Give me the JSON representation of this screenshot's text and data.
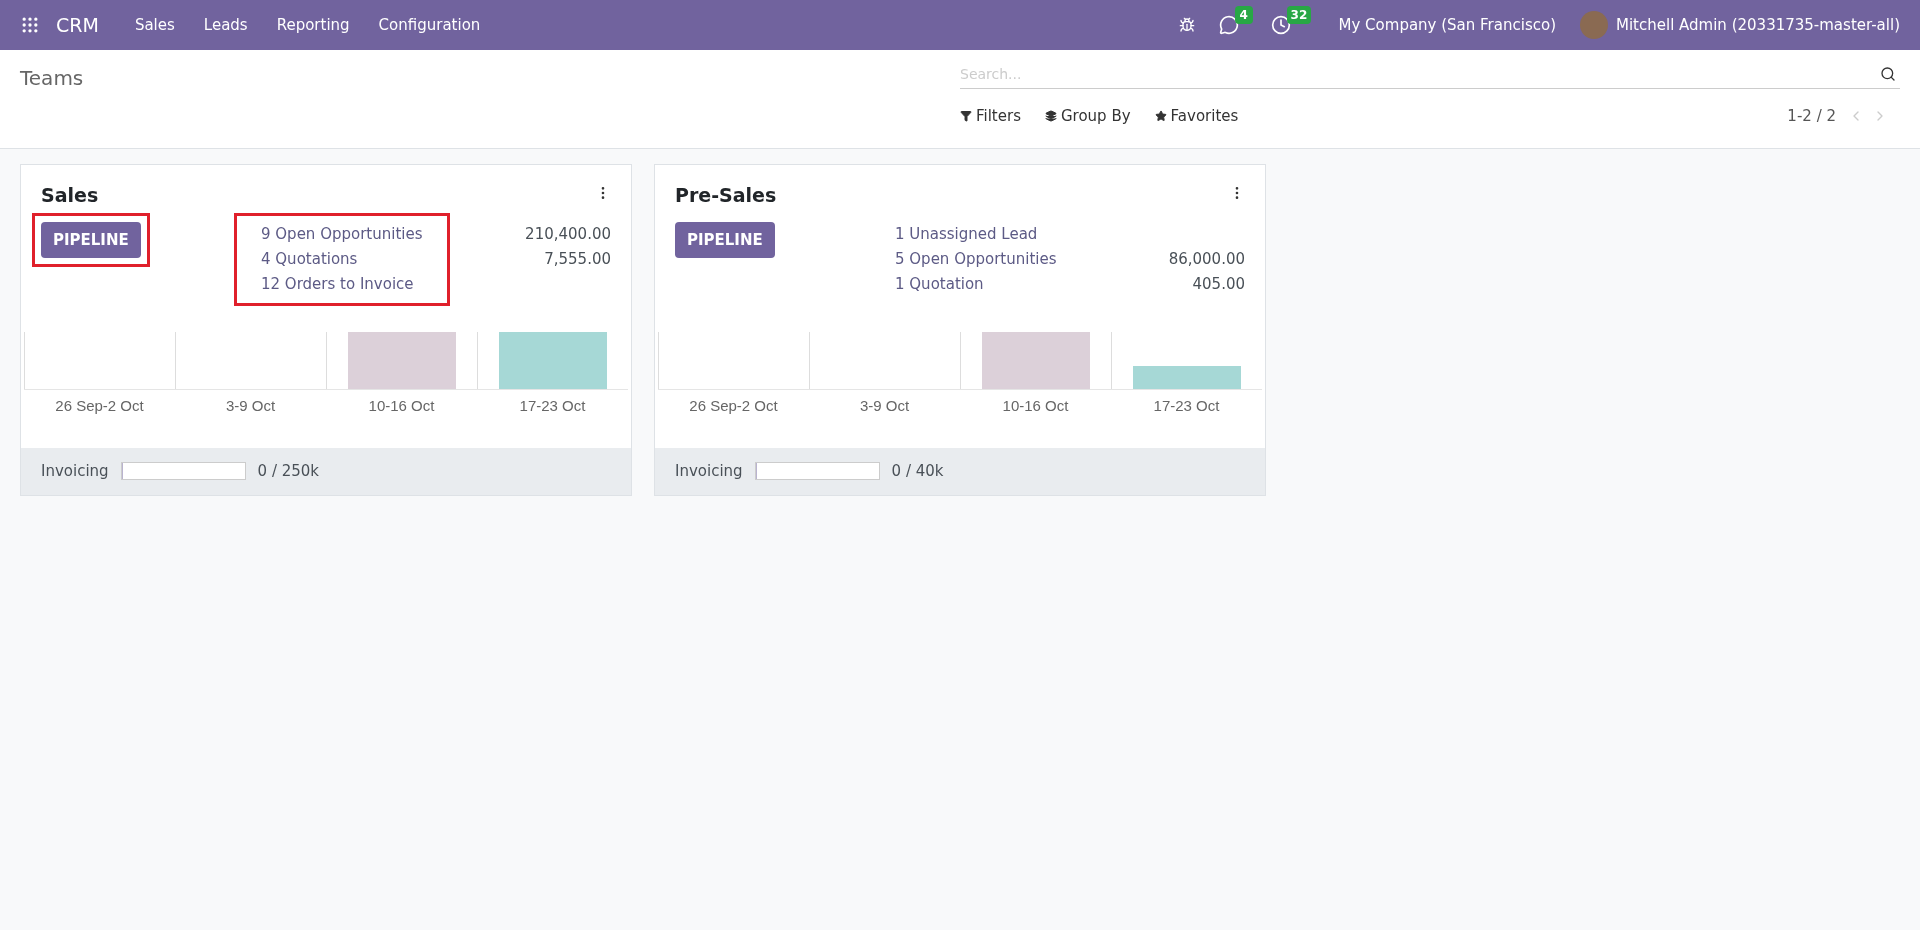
{
  "navbar": {
    "app": "CRM",
    "menu": [
      "Sales",
      "Leads",
      "Reporting",
      "Configuration"
    ],
    "messages_count": "4",
    "activities_count": "32",
    "company": "My Company (San Francisco)",
    "user": "Mitchell Admin (20331735-master-all)"
  },
  "control_panel": {
    "title": "Teams",
    "search": {
      "placeholder": "Search..."
    },
    "filters": [
      "Filters",
      "Group By",
      "Favorites"
    ],
    "pager": "1-2 / 2"
  },
  "teams": [
    {
      "name": "Sales",
      "button": "PIPELINE",
      "button_highlighted": true,
      "stats_highlighted": true,
      "stats": [
        {
          "label": "9 Open Opportunities",
          "amount": "210,400.00"
        },
        {
          "label": "4 Quotations",
          "amount": "7,555.00"
        },
        {
          "label": "12 Orders to Invoice"
        }
      ],
      "weeks": [
        "26 Sep-2 Oct",
        "3-9 Oct",
        "10-16 Oct",
        "17-23 Oct"
      ],
      "invoicing": {
        "label": "Invoicing",
        "level": 0,
        "reading": "0 / 250k"
      }
    },
    {
      "name": "Pre-Sales",
      "button": "PIPELINE",
      "button_highlighted": false,
      "stats_highlighted": false,
      "stats": [
        {
          "label": "1 Unassigned Lead"
        },
        {
          "label": "5 Open Opportunities",
          "amount": "86,000.00"
        },
        {
          "label": "1 Quotation",
          "amount": "405.00"
        }
      ],
      "weeks": [
        "26 Sep-2 Oct",
        "3-9 Oct",
        "10-16 Oct",
        "17-23 Oct"
      ],
      "invoicing": {
        "label": "Invoicing",
        "level": 0,
        "reading": "0 / 40k"
      }
    }
  ]
}
